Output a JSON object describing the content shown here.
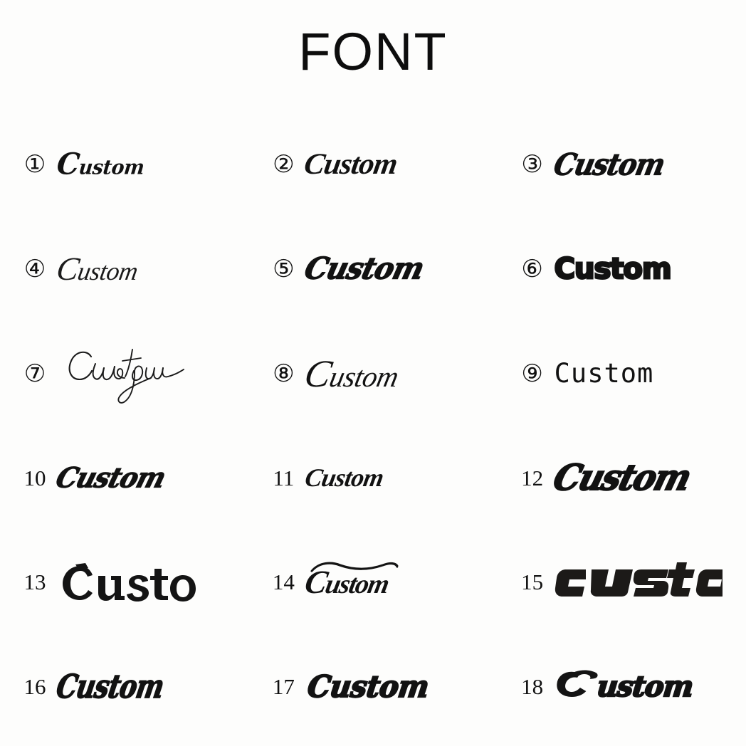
{
  "page": {
    "title": "FONT",
    "background_color": "#fdfdfc",
    "text_color": "#121212",
    "columns": 3,
    "rows": 6
  },
  "samples": [
    {
      "number": "1",
      "marker": "①",
      "circled": true,
      "text": "Custom",
      "style": "bold-italic-script-heart-swash"
    },
    {
      "number": "2",
      "marker": "②",
      "circled": true,
      "text": "Custom",
      "style": "classic-bold-italic-script"
    },
    {
      "number": "3",
      "marker": "③",
      "circled": true,
      "text": "Custom",
      "style": "heavy-baseball-script"
    },
    {
      "number": "4",
      "marker": "④",
      "circled": true,
      "text": "Custom",
      "style": "delicate-copperplate-script"
    },
    {
      "number": "5",
      "marker": "⑤",
      "circled": true,
      "text": "Custom",
      "style": "wide-bold-brush-script"
    },
    {
      "number": "6",
      "marker": "⑥",
      "circled": true,
      "text": "Custom",
      "style": "heavy-rounded-retro-sans"
    },
    {
      "number": "7",
      "marker": "⑦",
      "circled": true,
      "text": "Custom",
      "style": "thin-signature-handwriting"
    },
    {
      "number": "8",
      "marker": "⑧",
      "circled": true,
      "text": "Custom",
      "style": "light-formal-looping-script"
    },
    {
      "number": "9",
      "marker": "⑨",
      "circled": true,
      "text": "Custom",
      "style": "plain-monospace-sans"
    },
    {
      "number": "10",
      "marker": "10",
      "circled": false,
      "text": "Custom",
      "style": "rough-bold-brush-italic"
    },
    {
      "number": "11",
      "marker": "11",
      "circled": false,
      "text": "Custom",
      "style": "clean-medium-script"
    },
    {
      "number": "12",
      "marker": "12",
      "circled": false,
      "text": "Custom",
      "style": "very-heavy-bold-brush"
    },
    {
      "number": "13",
      "marker": "13",
      "circled": false,
      "text": "Custom",
      "style": "blackletter-old-english"
    },
    {
      "number": "14",
      "marker": "14",
      "circled": false,
      "text": "Custom",
      "style": "spencerian-overhead-swash"
    },
    {
      "number": "15",
      "marker": "15",
      "circled": false,
      "text": "custom",
      "style": "aggressive-racing-italic"
    },
    {
      "number": "16",
      "marker": "16",
      "circled": false,
      "text": "Custom",
      "style": "condensed-bold-script"
    },
    {
      "number": "17",
      "marker": "17",
      "circled": false,
      "text": "Custom",
      "style": "heavy-bold-italic-slab"
    },
    {
      "number": "18",
      "marker": "18",
      "circled": false,
      "text": "Custom",
      "style": "fat-retro-serif-swash"
    }
  ]
}
